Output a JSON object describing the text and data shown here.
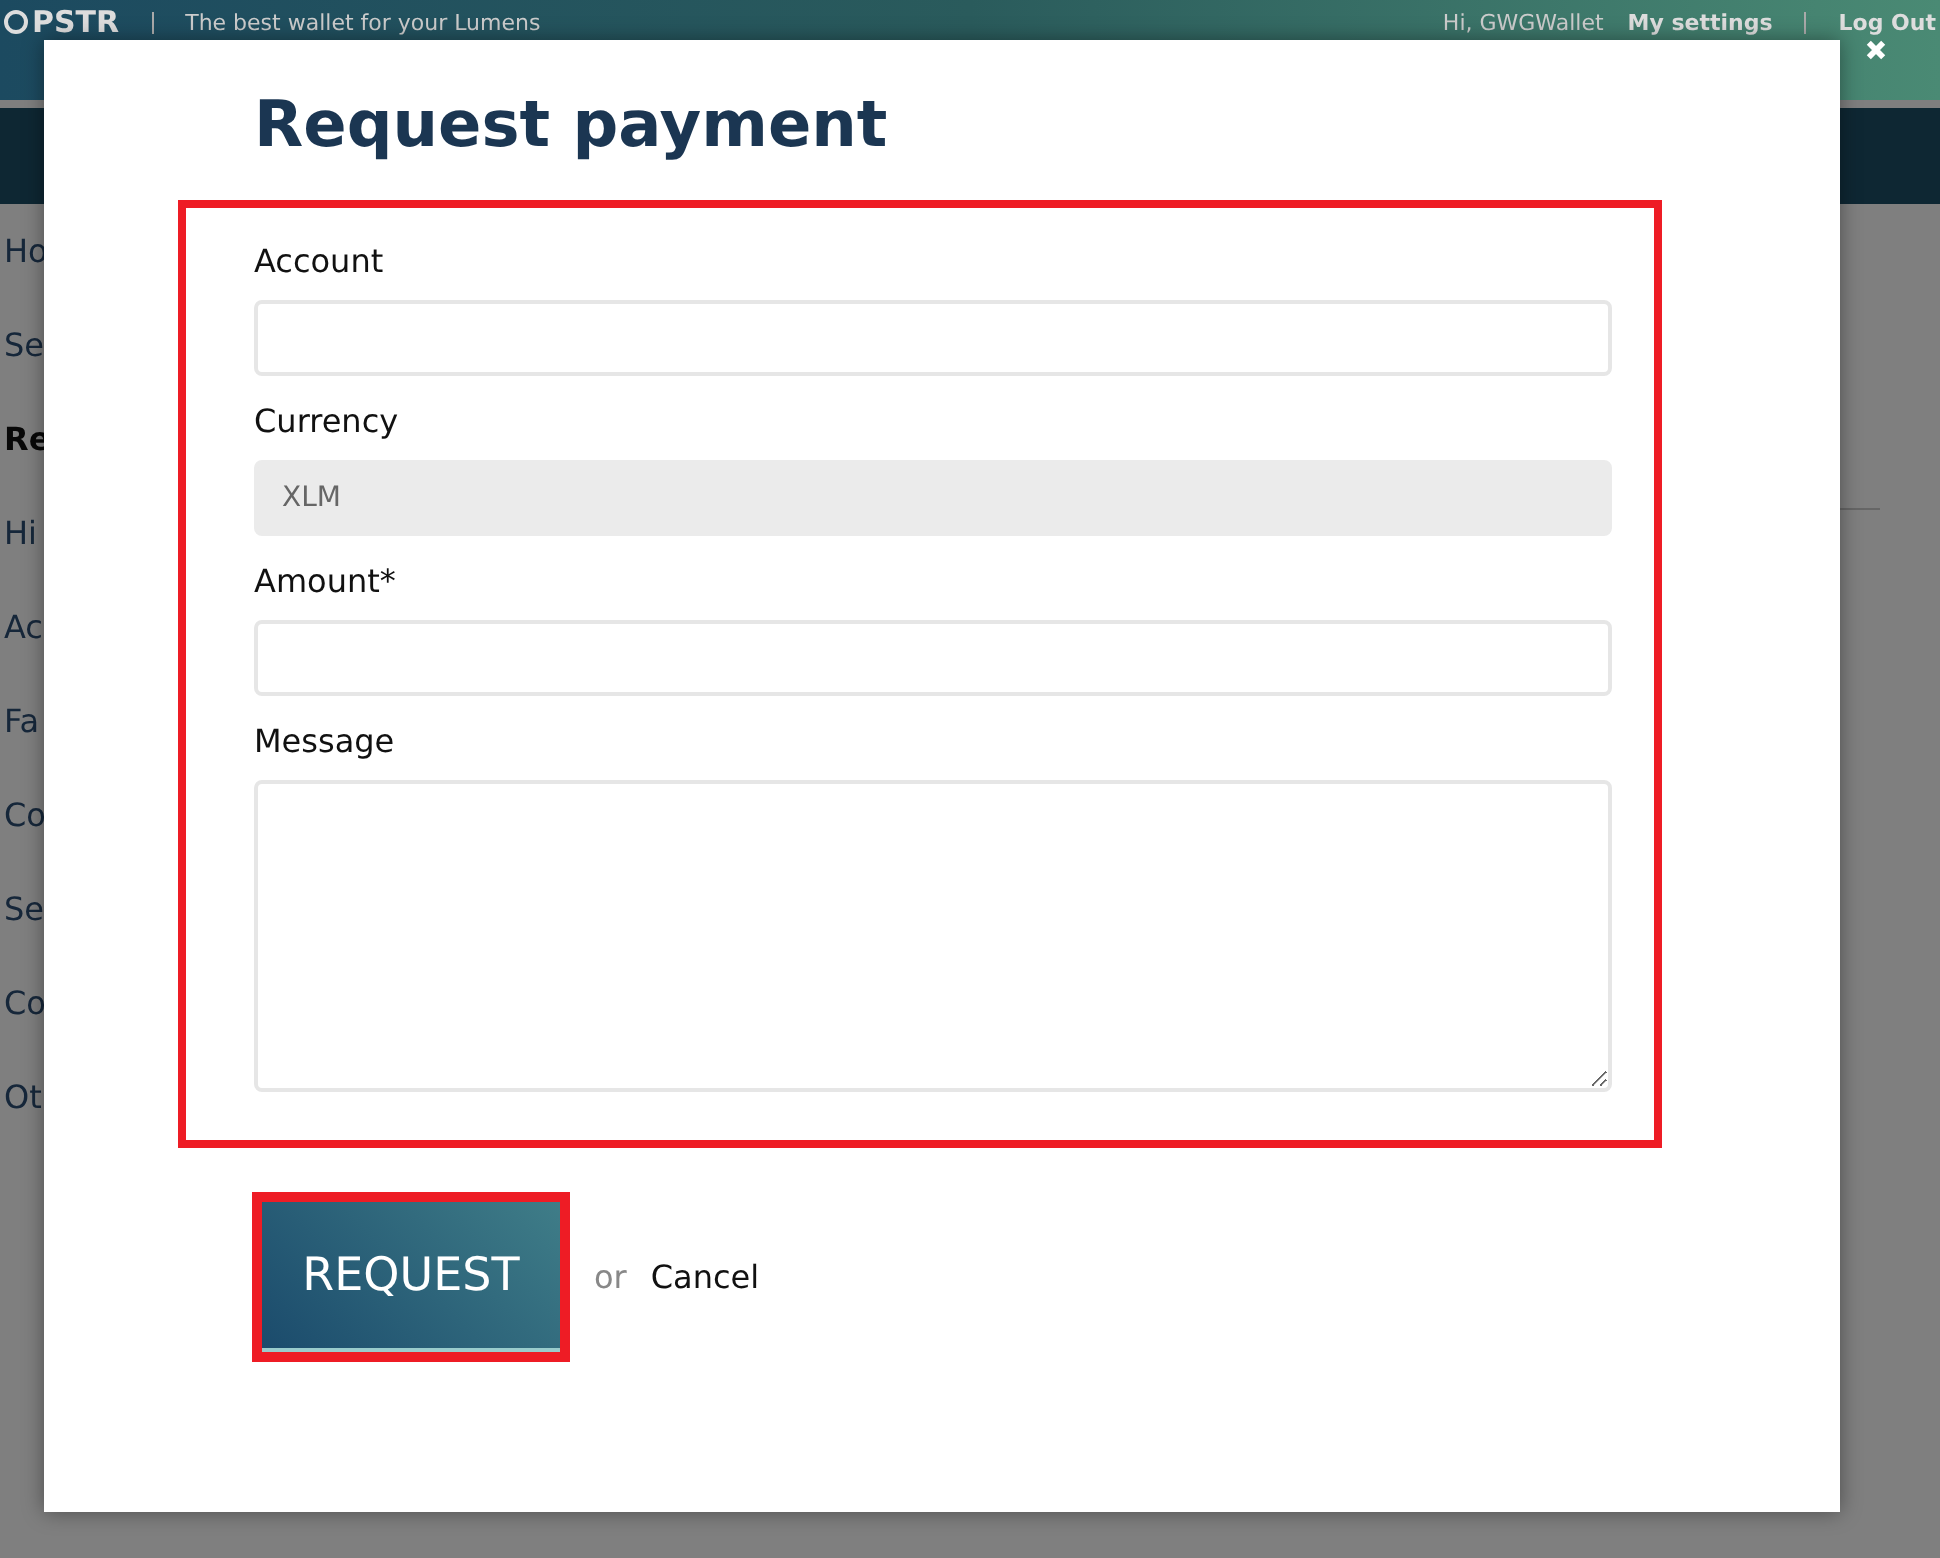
{
  "header": {
    "logo": "PSTR",
    "tagline": "The best wallet for your Lumens",
    "greeting": "Hi, GWGWallet",
    "links": [
      "My settings",
      "Log Out"
    ]
  },
  "sidebar": {
    "items": [
      {
        "label": "Ho",
        "selected": false
      },
      {
        "label": "Se",
        "selected": false
      },
      {
        "label": "Re",
        "selected": true
      },
      {
        "label": "Hi",
        "selected": false
      },
      {
        "label": "Ac",
        "selected": false
      },
      {
        "label": "Fa",
        "selected": false
      },
      {
        "label": "Co",
        "selected": false
      },
      {
        "label": "Se",
        "selected": false
      },
      {
        "label": "Co",
        "selected": false
      },
      {
        "label": "Ot",
        "selected": false
      }
    ]
  },
  "modal": {
    "title": "Request payment",
    "fields": [
      {
        "kind": "input",
        "label": "Account",
        "disabled": false
      },
      {
        "kind": "input",
        "label": "Currency",
        "value": "XLM",
        "disabled": true
      },
      {
        "kind": "input",
        "label": "Amount*",
        "disabled": false
      },
      {
        "kind": "textarea",
        "label": "Message",
        "disabled": false
      }
    ],
    "submit": "REQUEST",
    "separator": "or",
    "cancel": "Cancel",
    "highlighted": true
  }
}
